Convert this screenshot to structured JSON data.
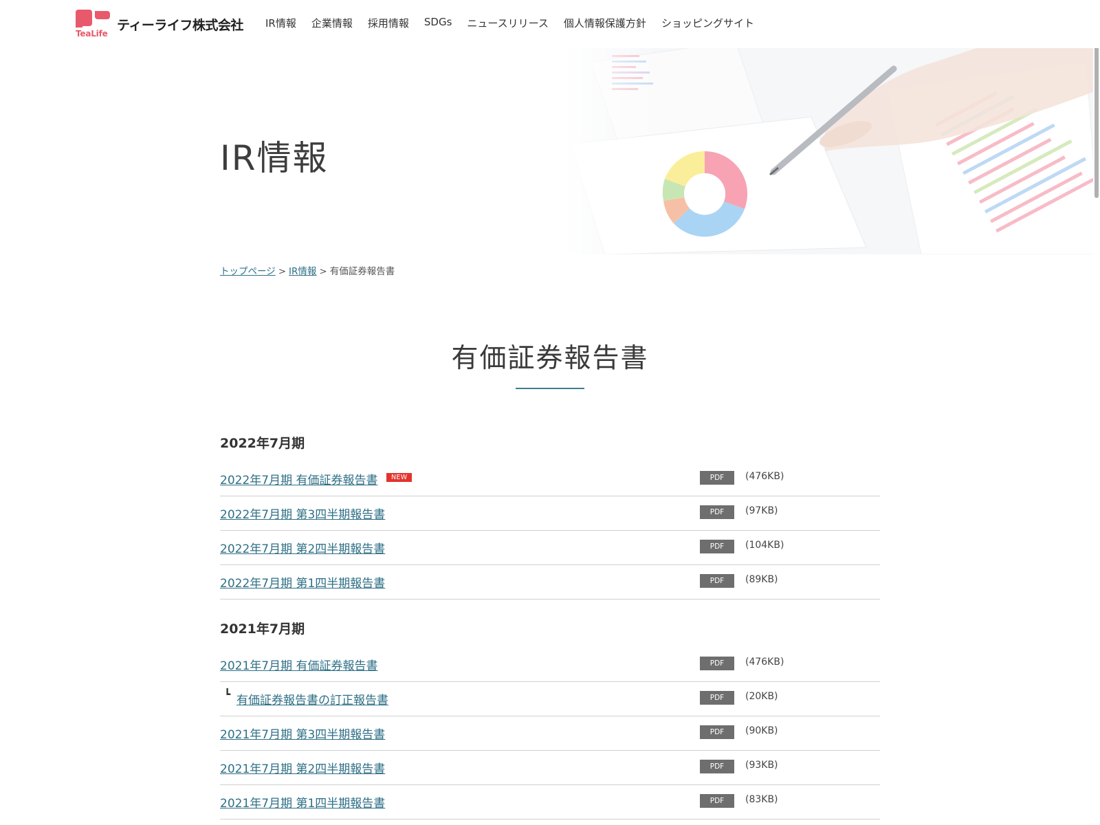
{
  "header": {
    "logo_text": "TeaLife",
    "company_name": "ティーライフ株式会社",
    "nav": [
      "IR情報",
      "企業情報",
      "採用情報",
      "SDGs",
      "ニュースリリース",
      "個人情報保護方針",
      "ショッピングサイト"
    ]
  },
  "hero": {
    "title": "IR情報"
  },
  "breadcrumb": {
    "items": [
      {
        "label": "トップページ",
        "link": true
      },
      {
        "label": "IR情報",
        "link": true
      },
      {
        "label": "有価証券報告書",
        "link": false
      }
    ],
    "separator": ">"
  },
  "section": {
    "title": "有価証券報告書",
    "pdf_label": "PDF",
    "new_label": "NEW",
    "sub_mark": "┗",
    "groups": [
      {
        "year": "2022年7月期",
        "docs": [
          {
            "title": "2022年7月期 有価証券報告書",
            "size": "(476KB)",
            "new": true
          },
          {
            "title": "2022年7月期 第3四半期報告書",
            "size": "(97KB)"
          },
          {
            "title": "2022年7月期 第2四半期報告書",
            "size": "(104KB)"
          },
          {
            "title": "2022年7月期 第1四半期報告書",
            "size": "(89KB)"
          }
        ]
      },
      {
        "year": "2021年7月期",
        "docs": [
          {
            "title": "2021年7月期 有価証券報告書",
            "size": "(476KB)"
          },
          {
            "title": "有価証券報告書の訂正報告書",
            "size": "(20KB)",
            "sub": true
          },
          {
            "title": "2021年7月期 第3四半期報告書",
            "size": "(90KB)"
          },
          {
            "title": "2021年7月期 第2四半期報告書",
            "size": "(93KB)"
          },
          {
            "title": "2021年7月期 第1四半期報告書",
            "size": "(83KB)"
          }
        ]
      }
    ]
  },
  "colors": {
    "brand": "#e8596b",
    "link": "#2e6f86",
    "accent_line": "#3e7d8f",
    "new_badge": "#e2342d",
    "pdf_badge": "#6e6e6e"
  }
}
